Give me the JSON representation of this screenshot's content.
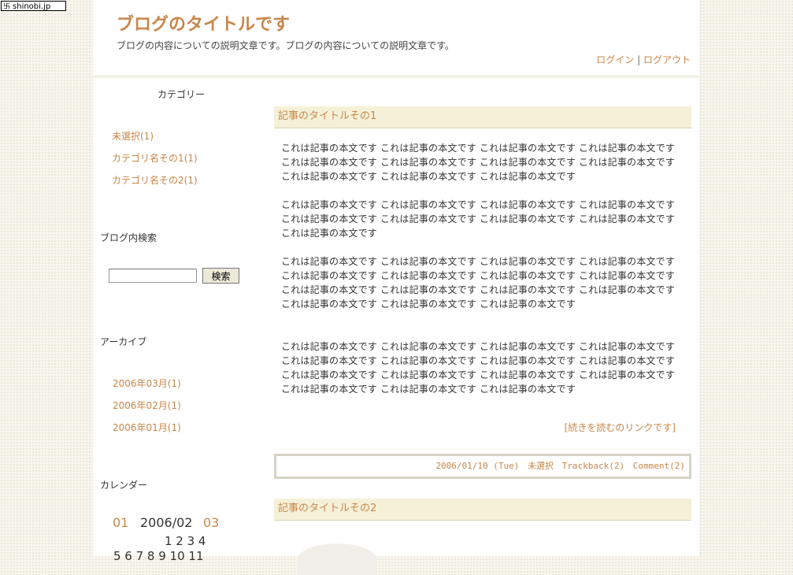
{
  "badge": {
    "icon": "shinobi-icon",
    "label": "shinobi.jp"
  },
  "header": {
    "title": "ブログのタイトルです",
    "description": "ブログの内容についての説明文章です。ブログの内容についての説明文章です。",
    "login": "ログイン",
    "separator": "|",
    "logout": "ログアウト"
  },
  "sidebar": {
    "categories_title": "カテゴリー",
    "categories": [
      "未選択(1)",
      "カテゴリ名その1(1)",
      "カテゴリ名その2(1)"
    ],
    "search_title": "ブログ内検索",
    "search_value": "",
    "search_button": "検索",
    "archive_title": "アーカイブ",
    "archives": [
      "2006年03月(1)",
      "2006年02月(1)",
      "2006年01月(1)"
    ],
    "calendar_title": "カレンダー",
    "calendar": {
      "prev": "01",
      "current": "2006/02",
      "next": "03",
      "row1": "1 2 3 4",
      "row2": "5 6 7 8 9 10 11"
    }
  },
  "posts": [
    {
      "title": "記事のタイトルその1",
      "paragraphs": [
        "これは記事の本文です これは記事の本文です これは記事の本文です これは記事の本文です これは記事の本文です これは記事の本文です これは記事の本文です これは記事の本文です これは記事の本文です これは記事の本文です これは記事の本文です",
        "これは記事の本文です これは記事の本文です これは記事の本文です これは記事の本文です これは記事の本文です これは記事の本文です これは記事の本文です これは記事の本文です これは記事の本文です",
        "これは記事の本文です これは記事の本文です これは記事の本文です これは記事の本文です これは記事の本文です これは記事の本文です これは記事の本文です これは記事の本文です これは記事の本文です これは記事の本文です これは記事の本文です これは記事の本文です これは記事の本文です これは記事の本文です これは記事の本文です",
        "これは記事の本文です これは記事の本文です これは記事の本文です これは記事の本文です これは記事の本文です これは記事の本文です これは記事の本文です これは記事の本文です これは記事の本文です これは記事の本文です これは記事の本文です これは記事の本文です これは記事の本文です これは記事の本文です これは記事の本文です"
      ],
      "more_link": "[続きを読むのリンクです]",
      "meta": {
        "date": "2006/01/10 (Tue)",
        "category": "未選択",
        "trackback": "Trackback(2)",
        "comment": "Comment(2)"
      }
    },
    {
      "title": "記事のタイトルその2"
    }
  ],
  "colors": {
    "accent": "#c8864a",
    "title_bar": "#f5f1d8",
    "text": "#333333"
  }
}
